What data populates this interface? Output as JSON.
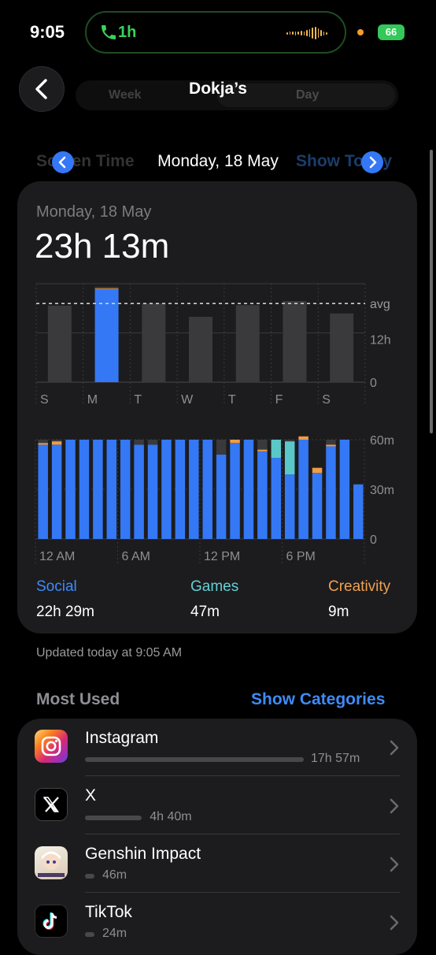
{
  "status_bar": {
    "time": "9:05",
    "call_duration": "1h",
    "battery": "66"
  },
  "nav": {
    "title": "Dokja’s",
    "segment_week": "Week",
    "segment_day": "Day"
  },
  "date_nav": {
    "date": "Monday, 18 May",
    "ghost_left": "Screen Time",
    "ghost_right": "Show Today"
  },
  "summary": {
    "date": "Monday, 18 May",
    "total": "23h 13m"
  },
  "chart_data": [
    {
      "type": "bar",
      "categories": [
        "S",
        "M",
        "T",
        "W",
        "T",
        "F",
        "S"
      ],
      "series": [
        {
          "name": "Social",
          "values": [
            0,
            22.5,
            0,
            0,
            0,
            0,
            0
          ]
        },
        {
          "name": "Creativity",
          "values": [
            0,
            0.15,
            0,
            0,
            0,
            0,
            0
          ]
        },
        {
          "name": "Other",
          "values": [
            18.5,
            0.4,
            19.0,
            15.8,
            18.6,
            19.6,
            16.6
          ]
        }
      ],
      "yticks": [
        "0",
        "12h"
      ],
      "avg_label": "avg",
      "average": 19.0,
      "ylim": [
        0,
        23.8
      ],
      "highlight_index": 1,
      "colors": {
        "Social": "#3478f6",
        "Creativity": "#f39c40",
        "Other": "#3a3a3c"
      }
    },
    {
      "type": "bar",
      "x": [
        0,
        1,
        2,
        3,
        4,
        5,
        6,
        7,
        8,
        9,
        10,
        11,
        12,
        13,
        14,
        15,
        16,
        17,
        18,
        19,
        20,
        21,
        22,
        23
      ],
      "xticks": [
        "12 AM",
        "6 AM",
        "12 PM",
        "6 PM"
      ],
      "yticks": [
        "0",
        "30m",
        "60m"
      ],
      "ylim": [
        0,
        60
      ],
      "series": [
        {
          "name": "Social",
          "values": [
            57,
            57,
            60,
            60,
            60,
            60,
            60,
            57,
            57,
            60,
            60,
            60,
            60,
            51,
            58,
            60,
            53,
            49,
            39,
            60,
            40,
            56,
            60,
            33
          ]
        },
        {
          "name": "Games",
          "values": [
            0,
            0,
            0,
            0,
            0,
            0,
            0,
            0,
            0,
            0,
            0,
            0,
            0,
            0,
            0,
            0,
            0,
            11,
            20,
            0,
            0,
            0,
            0,
            0
          ]
        },
        {
          "name": "Creativity",
          "values": [
            1,
            2,
            0,
            0,
            0,
            0,
            0,
            0,
            0,
            0,
            0,
            0,
            0,
            0,
            2,
            0,
            1,
            0,
            0,
            2,
            3,
            1,
            0,
            0
          ]
        },
        {
          "name": "Other",
          "values": [
            2,
            1,
            0,
            0,
            0,
            0,
            0,
            3,
            3,
            0,
            0,
            0,
            0,
            9,
            0,
            0,
            6,
            0,
            1,
            0,
            0,
            3,
            0,
            0
          ]
        }
      ],
      "colors": {
        "Social": "#3478f6",
        "Games": "#5ac8c8",
        "Creativity": "#f39c40",
        "Other": "#3a3a3c"
      }
    }
  ],
  "legend": [
    {
      "name": "Social",
      "value": "22h 29m",
      "color": "#3e8bf7"
    },
    {
      "name": "Games",
      "value": "47m",
      "color": "#63d0d5"
    },
    {
      "name": "Creativity",
      "value": "9m",
      "color": "#f0a050"
    }
  ],
  "updated": "Updated today at 9:05 AM",
  "most_used": {
    "heading": "Most Used",
    "show_categories": "Show Categories",
    "apps": [
      {
        "name": "Instagram",
        "time": "17h 57m",
        "fraction": 1.0,
        "icon": "instagram-icon"
      },
      {
        "name": "X",
        "time": "4h 40m",
        "fraction": 0.26,
        "icon": "x-icon"
      },
      {
        "name": "Genshin Impact",
        "time": "46m",
        "fraction": 0.04,
        "icon": "genshin-icon"
      },
      {
        "name": "TikTok",
        "time": "24m",
        "fraction": 0.03,
        "icon": "tiktok-icon"
      }
    ]
  }
}
